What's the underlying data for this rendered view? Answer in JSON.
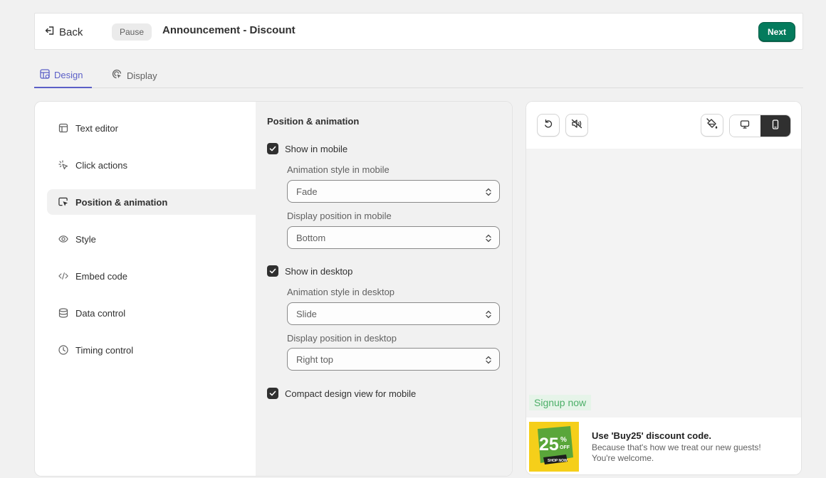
{
  "header": {
    "back_label": "Back",
    "status_badge": "Pause",
    "title": "Announcement - Discount",
    "next_label": "Next"
  },
  "tabs": [
    {
      "label": "Design",
      "active": true
    },
    {
      "label": "Display",
      "active": false
    }
  ],
  "side_menu": {
    "items": [
      {
        "label": "Text editor",
        "icon": "layout-icon"
      },
      {
        "label": "Click actions",
        "icon": "pointer-burst-icon"
      },
      {
        "label": "Position & animation",
        "icon": "cursor-select-icon",
        "active": true
      },
      {
        "label": "Style",
        "icon": "eye-icon"
      },
      {
        "label": "Embed code",
        "icon": "code-icon"
      },
      {
        "label": "Data control",
        "icon": "database-icon"
      },
      {
        "label": "Timing control",
        "icon": "clock-icon"
      }
    ]
  },
  "settings": {
    "title": "Position & animation",
    "show_mobile": {
      "label": "Show in mobile",
      "checked": true
    },
    "mobile_animation": {
      "label": "Animation style in mobile",
      "value": "Fade"
    },
    "mobile_position": {
      "label": "Display position in mobile",
      "value": "Bottom"
    },
    "show_desktop": {
      "label": "Show in desktop",
      "checked": true
    },
    "desktop_animation": {
      "label": "Animation style in desktop",
      "value": "Slide"
    },
    "desktop_position": {
      "label": "Display position in desktop",
      "value": "Right top"
    },
    "compact_mobile": {
      "label": "Compact design view for mobile",
      "checked": true
    }
  },
  "preview": {
    "toolbar": {
      "reset_icon": "undo-icon",
      "sound_icon": "sound-off-icon",
      "theme_icon": "paint-bucket-icon",
      "device_options": [
        "desktop-icon",
        "mobile-icon"
      ],
      "selected_device": "mobile"
    },
    "signup_label": "Signup now",
    "announcement": {
      "title": "Use 'Buy25' discount code.",
      "body": "Because that's how we treat our new guests! You're welcome.",
      "image_text_big": "25",
      "image_text_pct": "%",
      "image_text_off": "OFF",
      "image_text_shop": "SHOP NOW"
    }
  },
  "colors": {
    "accent": "#5b5fc7",
    "primary_button": "#047b5d",
    "signup_text": "#4caf68",
    "promo_yellow": "#f5cf1a",
    "promo_green": "#5aa63a"
  }
}
